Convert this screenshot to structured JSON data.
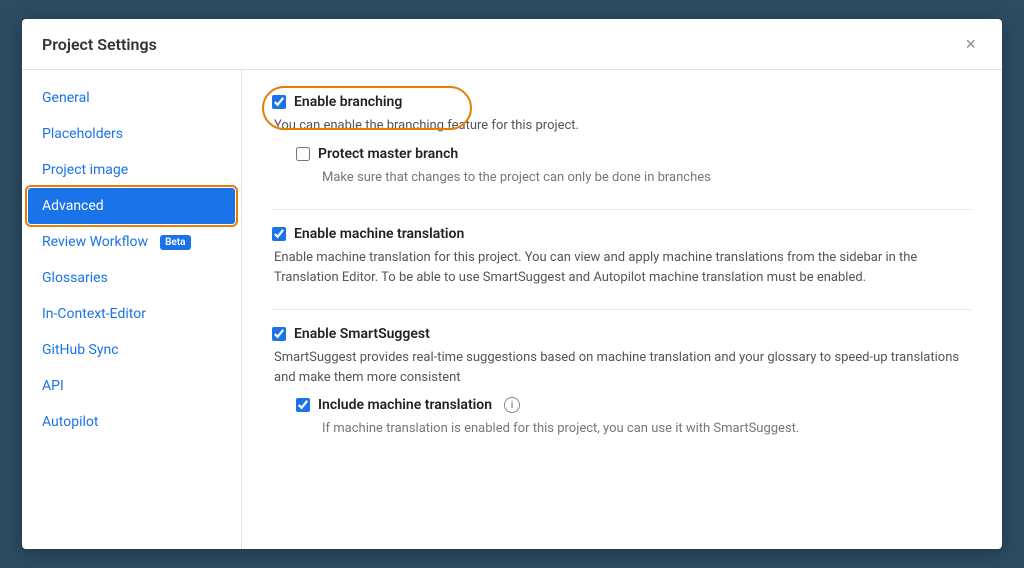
{
  "modal": {
    "title": "Project Settings",
    "close_label": "×"
  },
  "sidebar": {
    "items": [
      {
        "id": "general",
        "label": "General",
        "active": false,
        "has_beta": false
      },
      {
        "id": "placeholders",
        "label": "Placeholders",
        "active": false,
        "has_beta": false
      },
      {
        "id": "project-image",
        "label": "Project image",
        "active": false,
        "has_beta": false
      },
      {
        "id": "advanced",
        "label": "Advanced",
        "active": true,
        "has_beta": false
      },
      {
        "id": "review-workflow",
        "label": "Review Workflow",
        "active": false,
        "has_beta": true,
        "beta_label": "Beta"
      },
      {
        "id": "glossaries",
        "label": "Glossaries",
        "active": false,
        "has_beta": false
      },
      {
        "id": "in-context-editor",
        "label": "In-Context-Editor",
        "active": false,
        "has_beta": false
      },
      {
        "id": "github-sync",
        "label": "GitHub Sync",
        "active": false,
        "has_beta": false
      },
      {
        "id": "api",
        "label": "API",
        "active": false,
        "has_beta": false
      },
      {
        "id": "autopilot",
        "label": "Autopilot",
        "active": false,
        "has_beta": false
      }
    ]
  },
  "content": {
    "enable_branching": {
      "label": "Enable branching",
      "checked": true,
      "description": "You can enable the branching feature for this project."
    },
    "protect_master": {
      "label": "Protect master branch",
      "checked": false,
      "description": "Make sure that changes to the project can only be done in branches"
    },
    "enable_machine_translation": {
      "label": "Enable machine translation",
      "checked": true,
      "description": "Enable machine translation for this project. You can view and apply machine translations from the sidebar in the Translation Editor. To be able to use SmartSuggest and Autopilot machine translation must be enabled."
    },
    "enable_smartsuggest": {
      "label": "Enable SmartSuggest",
      "checked": true,
      "description": "SmartSuggest provides real-time suggestions based on machine translation and your glossary to speed-up translations and make them more consistent"
    },
    "include_machine_translation": {
      "label": "Include machine translation",
      "checked": true,
      "description": "If machine translation is enabled for this project, you can use it with SmartSuggest.",
      "has_info": true
    }
  }
}
